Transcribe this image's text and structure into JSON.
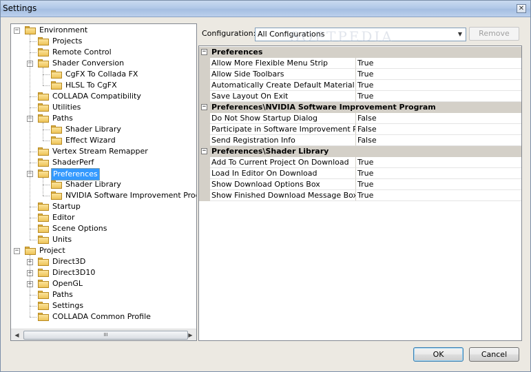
{
  "window": {
    "title": "Settings"
  },
  "tree": {
    "rows": [
      {
        "label": "Environment",
        "level": 0,
        "expander": "-"
      },
      {
        "label": "Projects",
        "level": 1,
        "expander": ""
      },
      {
        "label": "Remote Control",
        "level": 1,
        "expander": ""
      },
      {
        "label": "Shader Conversion",
        "level": 1,
        "expander": "-"
      },
      {
        "label": "CgFX To Collada FX",
        "level": 2,
        "expander": ""
      },
      {
        "label": "HLSL To CgFX",
        "level": 2,
        "expander": ""
      },
      {
        "label": "COLLADA Compatibility",
        "level": 1,
        "expander": ""
      },
      {
        "label": "Utilities",
        "level": 1,
        "expander": ""
      },
      {
        "label": "Paths",
        "level": 1,
        "expander": "-"
      },
      {
        "label": "Shader Library",
        "level": 2,
        "expander": ""
      },
      {
        "label": "Effect Wizard",
        "level": 2,
        "expander": ""
      },
      {
        "label": "Vertex Stream Remapper",
        "level": 1,
        "expander": ""
      },
      {
        "label": "ShaderPerf",
        "level": 1,
        "expander": ""
      },
      {
        "label": "Preferences",
        "level": 1,
        "expander": "-",
        "selected": true
      },
      {
        "label": "Shader Library",
        "level": 2,
        "expander": ""
      },
      {
        "label": "NVIDIA Software Improvement Program",
        "level": 2,
        "expander": ""
      },
      {
        "label": "Startup",
        "level": 1,
        "expander": ""
      },
      {
        "label": "Editor",
        "level": 1,
        "expander": ""
      },
      {
        "label": "Scene Options",
        "level": 1,
        "expander": ""
      },
      {
        "label": "Units",
        "level": 1,
        "expander": ""
      },
      {
        "label": "Project",
        "level": 0,
        "expander": "-"
      },
      {
        "label": "Direct3D",
        "level": 1,
        "expander": "+"
      },
      {
        "label": "Direct3D10",
        "level": 1,
        "expander": "+"
      },
      {
        "label": "OpenGL",
        "level": 1,
        "expander": "+"
      },
      {
        "label": "Paths",
        "level": 1,
        "expander": ""
      },
      {
        "label": "Settings",
        "level": 1,
        "expander": ""
      },
      {
        "label": "COLLADA Common Profile",
        "level": 1,
        "expander": ""
      }
    ],
    "scroll_grip": "III"
  },
  "config": {
    "label": "Configuration:",
    "value": "All Configurations",
    "remove_label": "Remove"
  },
  "watermark": "SOFTPEDIA",
  "grid": {
    "categories": [
      {
        "name": "Preferences",
        "props": [
          {
            "name": "Allow More Flexible Menu Strip",
            "value": "True"
          },
          {
            "name": "Allow Side Toolbars",
            "value": "True"
          },
          {
            "name": "Automatically Create Default Material",
            "value": "True"
          },
          {
            "name": "Save Layout On Exit",
            "value": "True"
          }
        ]
      },
      {
        "name": "Preferences\\NVIDIA Software Improvement Program",
        "props": [
          {
            "name": "Do Not Show Startup Dialog",
            "value": "False"
          },
          {
            "name": "Participate in Software Improvement Progra",
            "value": "False"
          },
          {
            "name": "Send Registration Info",
            "value": "False"
          }
        ]
      },
      {
        "name": "Preferences\\Shader Library",
        "props": [
          {
            "name": "Add To Current Project On Download",
            "value": "True"
          },
          {
            "name": "Load In Editor On Download",
            "value": "True"
          },
          {
            "name": "Show Download Options Box",
            "value": "True"
          },
          {
            "name": "Show Finished Download Message Box",
            "value": "True"
          }
        ]
      }
    ]
  },
  "buttons": {
    "ok": "OK",
    "cancel": "Cancel"
  }
}
